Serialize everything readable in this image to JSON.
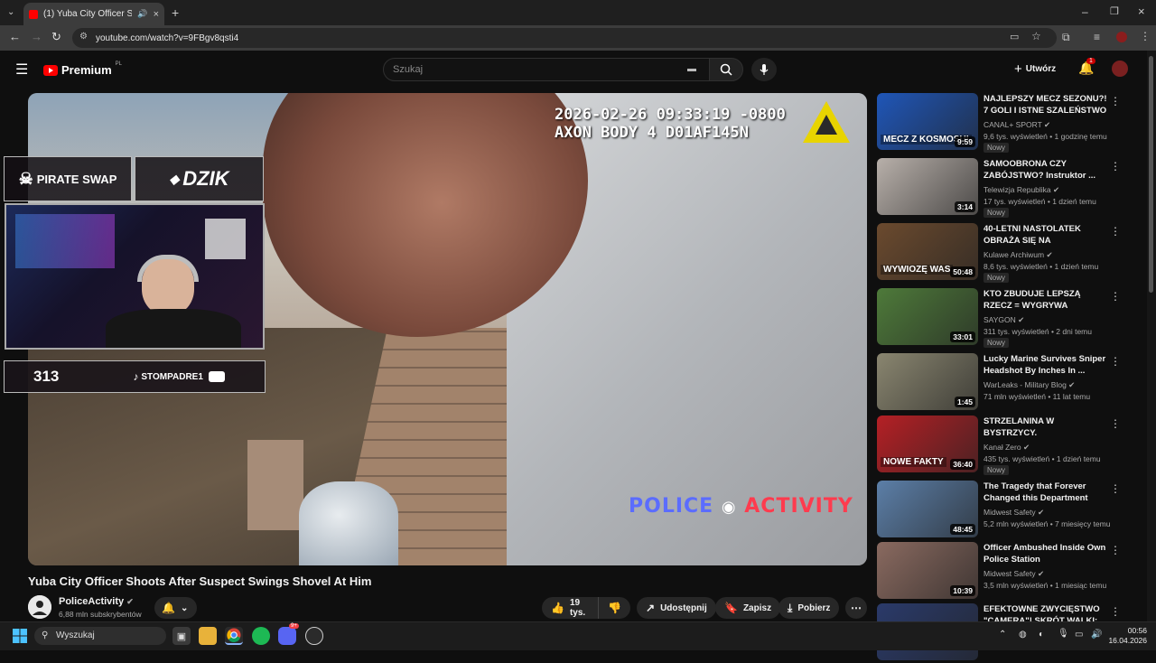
{
  "browser": {
    "tab_title": "(1) Yuba City Officer Shoots...",
    "url": "youtube.com/watch?v=9FBgv8qsti4"
  },
  "header": {
    "logo_text": "Premium",
    "logo_region": "PL",
    "search_placeholder": "Szukaj",
    "create_label": "Utwórz",
    "notification_count": "1"
  },
  "player": {
    "timestamp_line1": "2026-02-26 09:33:19 -0800",
    "timestamp_line2": "AXON BODY 4 D01AF145N",
    "watermark_part1": "POLICE",
    "watermark_part2": "ACTIVITY",
    "overlay": {
      "sponsor1": "PIRATE SWAP",
      "sponsor2": "DZIK",
      "viewer_count": "313",
      "social_handle": "STOMPADRE1"
    }
  },
  "video": {
    "title": "Yuba City Officer Shoots After Suspect Swings Shovel At Him",
    "channel_name": "PoliceActivity",
    "subscribers": "6,88 mln subskrybentów",
    "likes": "19 tys.",
    "share_label": "Udostępnij",
    "save_label": "Zapisz",
    "download_label": "Pobierz"
  },
  "recommendations": [
    {
      "title": "NAJLEPSZY MECZ SEZONU?! 7 GOLI I ISTNE SZALEŃSTWO W...",
      "channel": "CANAL+ SPORT",
      "meta": "9,6 tys. wyświetleń • 1 godzinę temu",
      "badge": "Nowy",
      "duration": "9:59",
      "thumb_text": "MECZ Z KOSMOSU!",
      "color": "#1f56b8"
    },
    {
      "title": "SAMOOBRONA CZY ZABÓJSTWO? Instruktor ...",
      "channel": "Telewizja Republika",
      "meta": "17 tys. wyświetleń • 1 dzień temu",
      "badge": "Nowy",
      "duration": "3:14",
      "thumb_text": "",
      "color": "#b8b0aa"
    },
    {
      "title": "40-LETNI NASTOLATEK OBRAŻA SIĘ NA POLICJANTÓ...",
      "channel": "Kulawe Archiwum",
      "meta": "8,6 tys. wyświetleń • 1 dzień temu",
      "badge": "Nowy",
      "duration": "50:48",
      "thumb_text": "WYWIOZĘ WAS",
      "color": "#6b4a2e"
    },
    {
      "title": "KTO ZBUDUJE LEPSZĄ RZECZ = WYGRYWA",
      "channel": "SAYGON",
      "meta": "311 tys. wyświetleń • 2 dni temu",
      "badge": "Nowy",
      "duration": "33:01",
      "thumb_text": "",
      "color": "#4e7a3a"
    },
    {
      "title": "Lucky Marine Survives Sniper Headshot By Inches In ...",
      "channel": "WarLeaks - Military Blog",
      "meta": "71 mln wyświetleń • 11 lat temu",
      "badge": "",
      "duration": "1:45",
      "thumb_text": "",
      "color": "#8a8670"
    },
    {
      "title": "STRZELANINA W BYSTRZYCY. ROZMAWIALIŚMY Z JEDNYM ...",
      "channel": "Kanał Zero",
      "meta": "435 tys. wyświetleń • 1 dzień temu",
      "badge": "Nowy",
      "duration": "36:40",
      "thumb_text": "NOWE FAKTY",
      "color": "#b52025"
    },
    {
      "title": "The Tragedy that Forever Changed this Department",
      "channel": "Midwest Safety",
      "meta": "5,2 mln wyświetleń • 7 miesięcy temu",
      "badge": "",
      "duration": "48:45",
      "thumb_text": "",
      "color": "#5c7fa8"
    },
    {
      "title": "Officer Ambushed Inside Own Police Station",
      "channel": "Midwest Safety",
      "meta": "3,5 mln wyświetleń • 1 miesiąc temu",
      "badge": "",
      "duration": "10:39",
      "thumb_text": "",
      "color": "#8a6a60"
    },
    {
      "title": "EFEKTOWNE ZWYCIĘSTWO \"CAMERA\"! SKRÓT WALKI:",
      "channel": "",
      "meta": "",
      "badge": "",
      "duration": "",
      "thumb_text": "",
      "color": "#2a3a6a"
    }
  ],
  "taskbar": {
    "search_label": "Wyszukaj",
    "time": "00:56",
    "date": "16.04.2026",
    "discord_badge": "9+"
  }
}
